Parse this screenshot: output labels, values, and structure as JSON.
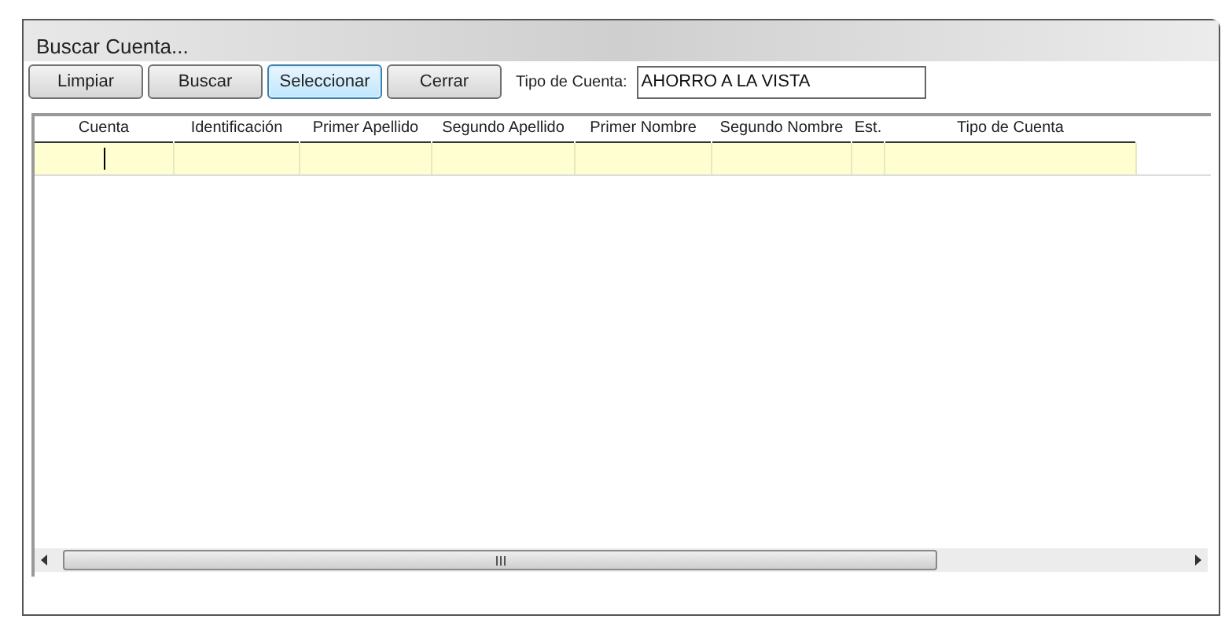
{
  "window": {
    "title": "Buscar Cuenta..."
  },
  "buttons": [
    {
      "label": "Limpiar",
      "selected": false
    },
    {
      "label": "Buscar",
      "selected": false
    },
    {
      "label": "Seleccionar",
      "selected": true
    },
    {
      "label": "Cerrar",
      "selected": false
    }
  ],
  "account_type": {
    "label": "Tipo de Cuenta:",
    "value": "AHORRO A LA VISTA"
  },
  "table": {
    "columns": [
      "Cuenta",
      "Identificación",
      "Primer Apellido",
      "Segundo Apellido",
      "Primer Nombre",
      "Segundo Nombre",
      "Est.",
      "Tipo de Cuenta"
    ]
  }
}
